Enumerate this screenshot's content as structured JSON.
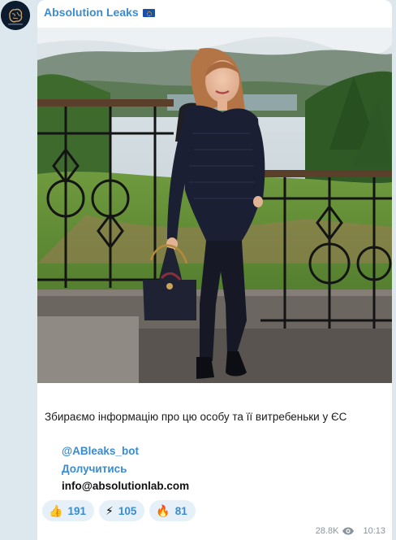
{
  "channel": {
    "name": "Absolution Leaks",
    "flag_icon": "eu-flag-icon"
  },
  "avatar": {
    "icon": "brain-logo-icon"
  },
  "photo": {
    "subject": "person",
    "icon": "photo-icon"
  },
  "message": {
    "caption": "Збираємо інформацію про цю особу та її витребеньки у ЄС",
    "bot_link": "@ABleaks_bot",
    "join_link": "Долучитись",
    "email": "info@absolutionlab.com"
  },
  "reactions": [
    {
      "emoji": "👍",
      "icon": "thumbs-up-icon",
      "count": "191"
    },
    {
      "emoji": "⚡",
      "icon": "lightning-icon",
      "count": "105"
    },
    {
      "emoji": "🔥",
      "icon": "fire-icon",
      "count": "81"
    }
  ],
  "meta": {
    "views": "28.8K",
    "time": "10:13",
    "views_icon": "eye-icon"
  },
  "colors": {
    "accent": "#3a8ccf",
    "background": "#dde7ee",
    "reaction_bg": "#e6f0f8"
  }
}
